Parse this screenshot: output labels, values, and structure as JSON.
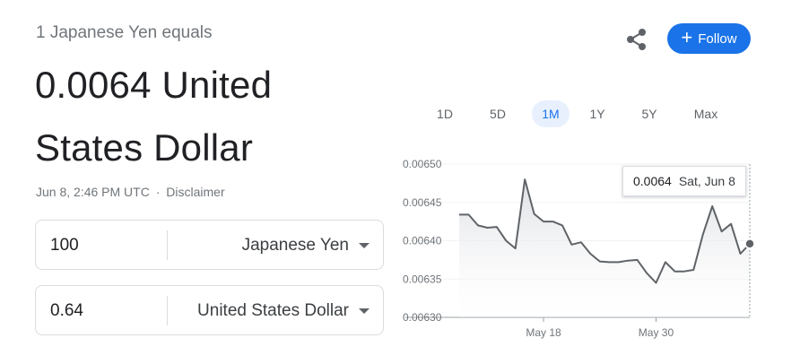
{
  "header": {
    "subtitle": "1 Japanese Yen equals",
    "rate_text": "0.0064 United States Dollar",
    "timestamp": "Jun 8, 2:46 PM UTC",
    "separator": "·",
    "disclaimer": "Disclaimer"
  },
  "actions": {
    "share_icon": "share-icon",
    "follow_label": "Follow",
    "follow_color": "#1a73e8"
  },
  "converter": {
    "from": {
      "amount": "100",
      "currency": "Japanese Yen"
    },
    "to": {
      "amount": "0.64",
      "currency": "United States Dollar"
    }
  },
  "ranges": [
    "1D",
    "5D",
    "1M",
    "1Y",
    "5Y",
    "Max"
  ],
  "active_range": "1M",
  "tooltip": {
    "value": "0.0064",
    "date": "Sat, Jun 8"
  },
  "chart_data": {
    "type": "area",
    "title": "",
    "xlabel": "",
    "ylabel": "",
    "ylim": [
      0.0063,
      0.0065
    ],
    "y_ticks": [
      "0.00650",
      "0.00645",
      "0.00640",
      "0.00635",
      "0.00630"
    ],
    "x_tick_labels": [
      {
        "label": "May 18",
        "index": 9
      },
      {
        "label": "May 30",
        "index": 21
      }
    ],
    "series": [
      {
        "values": [
          0.006434,
          0.006434,
          0.00642,
          0.006417,
          0.006418,
          0.0064,
          0.00639,
          0.00648,
          0.006435,
          0.006425,
          0.006425,
          0.00642,
          0.006395,
          0.006398,
          0.006383,
          0.006373,
          0.006372,
          0.006372,
          0.006374,
          0.006375,
          0.006358,
          0.006345,
          0.006372,
          0.00636,
          0.00636,
          0.006362,
          0.006408,
          0.006445,
          0.006412,
          0.006422,
          0.006383,
          0.006396
        ]
      }
    ],
    "line_color": "#5f6368",
    "fill_color": "#e8eaed",
    "grid": true
  }
}
